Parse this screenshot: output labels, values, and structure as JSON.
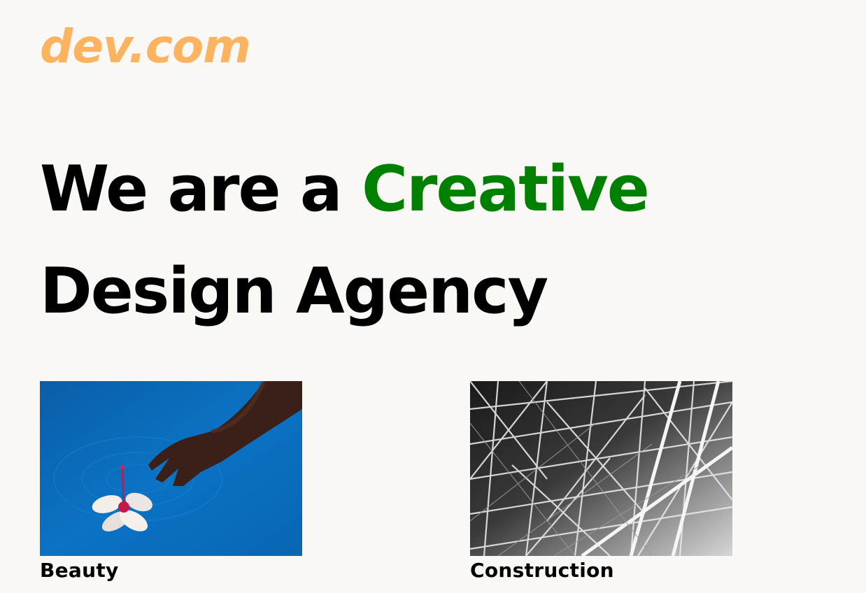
{
  "header": {
    "logo_text": "dev.com",
    "logo_color": "#fbb360"
  },
  "hero": {
    "line1_prefix": "We are a ",
    "line1_accent": "Creative",
    "line2": "Design Agency",
    "accent_color": "#008000"
  },
  "cards": [
    {
      "label": "Beauty",
      "image": "hand-with-flower-in-water-image"
    },
    {
      "label": "Construction",
      "image": "steel-truss-structure-image"
    }
  ]
}
